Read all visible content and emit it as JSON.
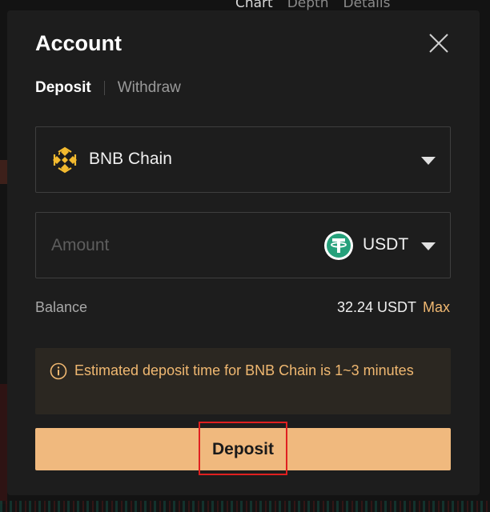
{
  "background": {
    "tabs": [
      "Chart",
      "Depth",
      "Details"
    ]
  },
  "modal": {
    "title": "Account",
    "tabs": [
      {
        "label": "Deposit",
        "active": true
      },
      {
        "label": "Withdraw",
        "active": false
      }
    ],
    "network": {
      "selected": "BNB Chain",
      "icon": "bnb-chain-icon"
    },
    "amount": {
      "placeholder": "Amount",
      "value": "",
      "token": "USDT",
      "token_icon": "usdt-icon"
    },
    "balance": {
      "label": "Balance",
      "value": "32.24 USDT",
      "max_label": "Max"
    },
    "notice": {
      "icon": "info-icon",
      "text": "Estimated deposit time for BNB Chain is 1~3 minutes"
    },
    "deposit_button": "Deposit",
    "colors": {
      "accent": "#f0b97e",
      "notice_text": "#f0b871",
      "modal_bg": "#1d1d1d",
      "highlight": "#e02020"
    }
  }
}
